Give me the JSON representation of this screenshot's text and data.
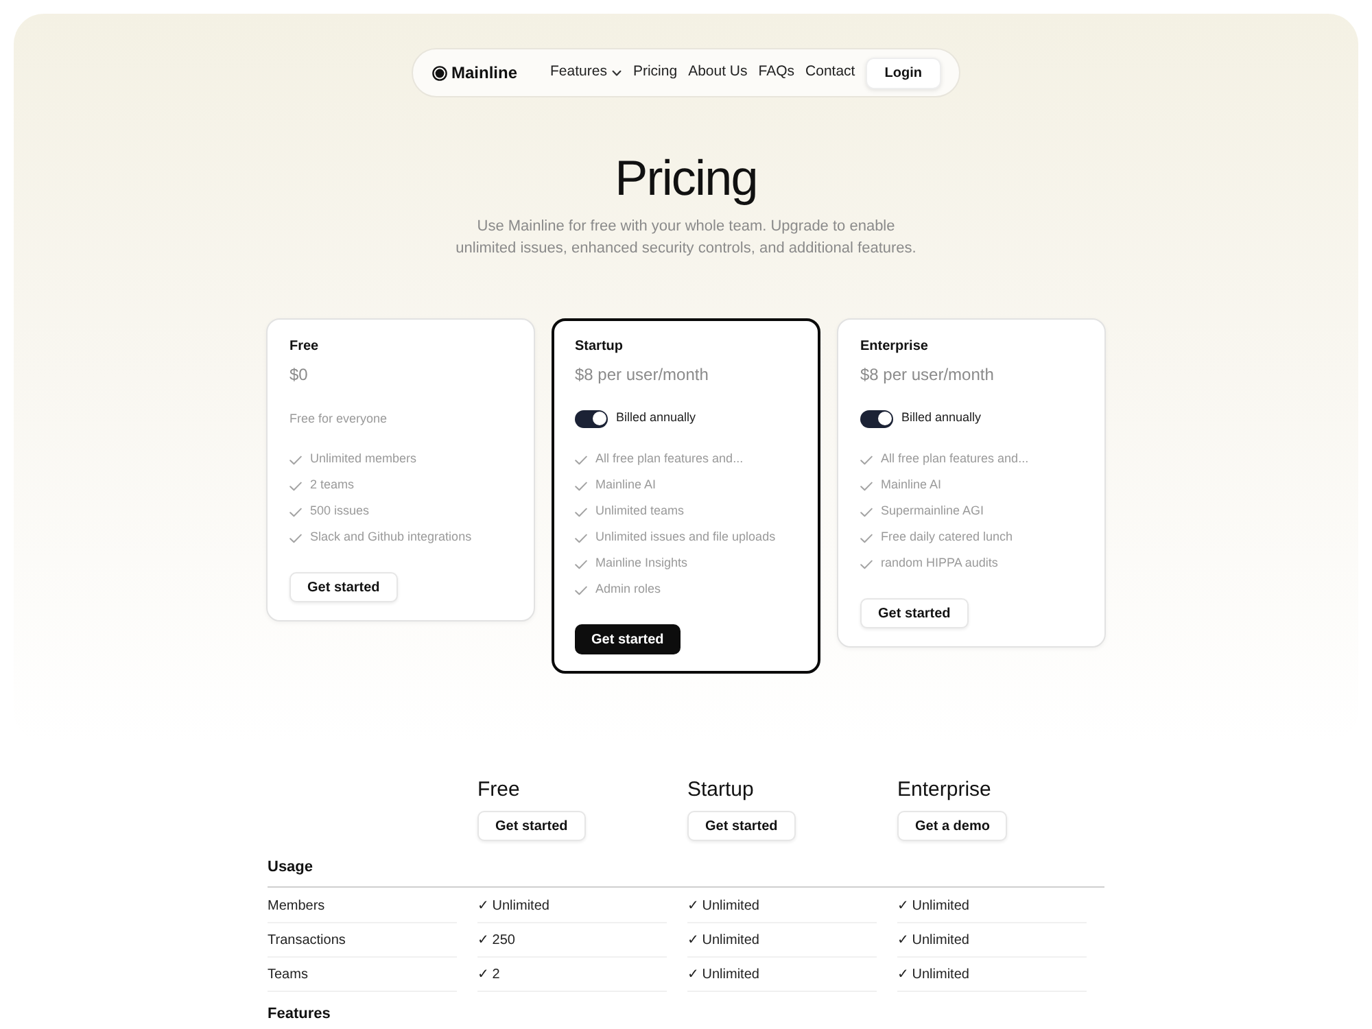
{
  "nav": {
    "logo": "Mainline",
    "links": [
      {
        "label": "Features",
        "dropdown": true
      },
      {
        "label": "Pricing",
        "dropdown": false
      },
      {
        "label": "About Us",
        "dropdown": false
      },
      {
        "label": "FAQs",
        "dropdown": false
      },
      {
        "label": "Contact",
        "dropdown": false
      }
    ],
    "login": "Login"
  },
  "hero": {
    "title": "Pricing",
    "subtitle": "Use Mainline for free with your whole team. Upgrade to enable unlimited issues, enhanced security controls, and additional features."
  },
  "plans": [
    {
      "name": "Free",
      "price": "$0",
      "highlighted": false,
      "note": "Free for everyone",
      "features": [
        "Unlimited members",
        "2 teams",
        "500 issues",
        "Slack and Github integrations"
      ],
      "button": "Get started"
    },
    {
      "name": "Startup",
      "price": "$8 per user/month",
      "highlighted": true,
      "billing": {
        "label": "Billed annually",
        "on": true
      },
      "features": [
        "All free plan features and...",
        "Mainline AI",
        "Unlimited teams",
        "Unlimited issues and file uploads",
        "Mainline Insights",
        "Admin roles"
      ],
      "button": "Get started"
    },
    {
      "name": "Enterprise",
      "price": "$8 per user/month",
      "highlighted": false,
      "billing": {
        "label": "Billed annually",
        "on": true
      },
      "features": [
        "All free plan features and...",
        "Mainline AI",
        "Supermainline AGI",
        "Free daily catered lunch",
        "random HIPPA audits"
      ],
      "button": "Get started"
    }
  ],
  "comparison": {
    "columns": [
      {
        "name": "Free",
        "button": "Get started"
      },
      {
        "name": "Startup",
        "button": "Get started"
      },
      {
        "name": "Enterprise",
        "button": "Get a demo"
      }
    ],
    "sections": [
      {
        "title": "Usage",
        "rows": [
          {
            "label": "Members",
            "values": [
              "✓ Unlimited",
              "✓ Unlimited",
              "✓ Unlimited"
            ]
          },
          {
            "label": "Transactions",
            "values": [
              "✓ 250",
              "✓ Unlimited",
              "✓ Unlimited"
            ]
          },
          {
            "label": "Teams",
            "values": [
              "✓ 2",
              "✓ Unlimited",
              "✓ Unlimited"
            ]
          }
        ]
      },
      {
        "title": "Features"
      }
    ]
  }
}
